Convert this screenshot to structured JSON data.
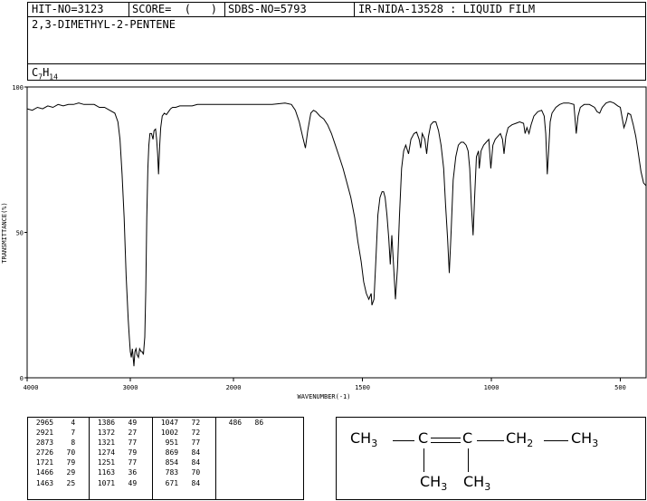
{
  "header": {
    "hit_no": "HIT-NO=3123",
    "score": "SCORE=  (   )",
    "sdbs_no": "SDBS-NO=5793",
    "nida": "IR-NIDA-13528 : LIQUID FILM",
    "compound_name": "2,3-DIMETHYL-2-PENTENE",
    "formula_main": "C",
    "formula_sub1": "7",
    "formula_mid": "H",
    "formula_sub2": "14"
  },
  "chart_data": {
    "type": "line",
    "xlabel": "WAVENUMBER(-1)",
    "ylabel": "TRANSMITTANCE(%)",
    "xlim": [
      4000,
      400
    ],
    "ylim": [
      0,
      100
    ],
    "x_ticks": [
      "4000",
      "3000",
      "2000",
      "1500",
      "1000",
      "500"
    ],
    "y_ticks": [
      "100",
      "50",
      "0"
    ],
    "series": [
      {
        "points": [
          [
            4000,
            92.5
          ],
          [
            3950,
            92
          ],
          [
            3900,
            93
          ],
          [
            3850,
            92.5
          ],
          [
            3800,
            93.5
          ],
          [
            3750,
            93
          ],
          [
            3700,
            94
          ],
          [
            3650,
            93.5
          ],
          [
            3600,
            94
          ],
          [
            3550,
            94
          ],
          [
            3500,
            94.5
          ],
          [
            3450,
            94
          ],
          [
            3400,
            94
          ],
          [
            3350,
            94
          ],
          [
            3300,
            93
          ],
          [
            3250,
            93
          ],
          [
            3200,
            92
          ],
          [
            3150,
            91
          ],
          [
            3120,
            88
          ],
          [
            3100,
            82
          ],
          [
            3080,
            70
          ],
          [
            3060,
            55
          ],
          [
            3040,
            35
          ],
          [
            3020,
            20
          ],
          [
            3010,
            14
          ],
          [
            3000,
            9
          ],
          [
            2990,
            7
          ],
          [
            2980,
            10
          ],
          [
            2965,
            4
          ],
          [
            2955,
            9
          ],
          [
            2945,
            10
          ],
          [
            2935,
            8
          ],
          [
            2921,
            7
          ],
          [
            2910,
            10
          ],
          [
            2895,
            9
          ],
          [
            2885,
            9
          ],
          [
            2873,
            8
          ],
          [
            2860,
            14
          ],
          [
            2850,
            30
          ],
          [
            2840,
            55
          ],
          [
            2830,
            72
          ],
          [
            2820,
            80
          ],
          [
            2810,
            84
          ],
          [
            2795,
            84
          ],
          [
            2780,
            82
          ],
          [
            2770,
            85
          ],
          [
            2755,
            85.5
          ],
          [
            2745,
            82
          ],
          [
            2735,
            77
          ],
          [
            2726,
            70
          ],
          [
            2715,
            80
          ],
          [
            2705,
            86
          ],
          [
            2690,
            90
          ],
          [
            2670,
            91
          ],
          [
            2650,
            90.5
          ],
          [
            2630,
            91.5
          ],
          [
            2610,
            92.5
          ],
          [
            2590,
            93
          ],
          [
            2560,
            93
          ],
          [
            2520,
            93.5
          ],
          [
            2480,
            93.5
          ],
          [
            2440,
            93.5
          ],
          [
            2400,
            93.5
          ],
          [
            2350,
            94
          ],
          [
            2300,
            94
          ],
          [
            2250,
            94
          ],
          [
            2200,
            94
          ],
          [
            2150,
            94
          ],
          [
            2100,
            94
          ],
          [
            2050,
            94
          ],
          [
            2000,
            94
          ],
          [
            1950,
            94
          ],
          [
            1900,
            94
          ],
          [
            1850,
            94
          ],
          [
            1800,
            94.5
          ],
          [
            1775,
            94
          ],
          [
            1760,
            92
          ],
          [
            1745,
            88
          ],
          [
            1732,
            83
          ],
          [
            1721,
            79
          ],
          [
            1712,
            85
          ],
          [
            1700,
            91
          ],
          [
            1690,
            92
          ],
          [
            1680,
            91.5
          ],
          [
            1665,
            90
          ],
          [
            1650,
            89
          ],
          [
            1635,
            87
          ],
          [
            1620,
            84
          ],
          [
            1605,
            80
          ],
          [
            1590,
            76
          ],
          [
            1575,
            72
          ],
          [
            1560,
            67
          ],
          [
            1545,
            62
          ],
          [
            1530,
            55
          ],
          [
            1518,
            47
          ],
          [
            1505,
            40
          ],
          [
            1495,
            33
          ],
          [
            1485,
            29
          ],
          [
            1475,
            27
          ],
          [
            1466,
            29
          ],
          [
            1463,
            25
          ],
          [
            1455,
            27
          ],
          [
            1448,
            40
          ],
          [
            1440,
            56
          ],
          [
            1432,
            62
          ],
          [
            1424,
            64
          ],
          [
            1418,
            64
          ],
          [
            1412,
            62
          ],
          [
            1405,
            56
          ],
          [
            1398,
            48
          ],
          [
            1392,
            39
          ],
          [
            1386,
            49
          ],
          [
            1380,
            40
          ],
          [
            1372,
            27
          ],
          [
            1364,
            38
          ],
          [
            1356,
            56
          ],
          [
            1348,
            72
          ],
          [
            1340,
            78
          ],
          [
            1332,
            80
          ],
          [
            1321,
            77
          ],
          [
            1312,
            82
          ],
          [
            1300,
            84
          ],
          [
            1290,
            84.5
          ],
          [
            1280,
            82
          ],
          [
            1274,
            79
          ],
          [
            1268,
            84
          ],
          [
            1258,
            82
          ],
          [
            1251,
            77
          ],
          [
            1244,
            83
          ],
          [
            1235,
            87
          ],
          [
            1225,
            88
          ],
          [
            1215,
            88
          ],
          [
            1205,
            85
          ],
          [
            1195,
            80
          ],
          [
            1185,
            72
          ],
          [
            1178,
            60
          ],
          [
            1170,
            48
          ],
          [
            1163,
            36
          ],
          [
            1156,
            50
          ],
          [
            1148,
            68
          ],
          [
            1138,
            76
          ],
          [
            1128,
            80
          ],
          [
            1118,
            81
          ],
          [
            1108,
            81
          ],
          [
            1098,
            80
          ],
          [
            1090,
            78
          ],
          [
            1084,
            72
          ],
          [
            1078,
            60
          ],
          [
            1071,
            49
          ],
          [
            1065,
            62
          ],
          [
            1058,
            76
          ],
          [
            1050,
            78
          ],
          [
            1047,
            72
          ],
          [
            1040,
            78
          ],
          [
            1030,
            80
          ],
          [
            1020,
            81
          ],
          [
            1010,
            82
          ],
          [
            1002,
            72
          ],
          [
            994,
            80
          ],
          [
            985,
            82
          ],
          [
            975,
            83
          ],
          [
            965,
            84
          ],
          [
            957,
            82
          ],
          [
            951,
            77
          ],
          [
            944,
            83
          ],
          [
            935,
            86
          ],
          [
            920,
            87
          ],
          [
            905,
            87.5
          ],
          [
            890,
            88
          ],
          [
            875,
            87.5
          ],
          [
            869,
            84
          ],
          [
            862,
            86
          ],
          [
            854,
            84
          ],
          [
            846,
            87
          ],
          [
            835,
            90
          ],
          [
            820,
            91.5
          ],
          [
            805,
            92
          ],
          [
            795,
            90
          ],
          [
            789,
            84
          ],
          [
            783,
            70
          ],
          [
            778,
            78
          ],
          [
            772,
            88
          ],
          [
            765,
            91
          ],
          [
            750,
            93
          ],
          [
            735,
            94
          ],
          [
            720,
            94.5
          ],
          [
            700,
            94.5
          ],
          [
            680,
            94
          ],
          [
            671,
            84
          ],
          [
            664,
            90
          ],
          [
            655,
            93
          ],
          [
            640,
            94
          ],
          [
            620,
            94
          ],
          [
            600,
            93
          ],
          [
            590,
            91.5
          ],
          [
            580,
            91
          ],
          [
            570,
            93
          ],
          [
            555,
            94.5
          ],
          [
            540,
            95
          ],
          [
            525,
            94.5
          ],
          [
            510,
            93.5
          ],
          [
            500,
            93
          ],
          [
            486,
            86
          ],
          [
            478,
            88
          ],
          [
            470,
            91
          ],
          [
            460,
            90.5
          ],
          [
            450,
            87
          ],
          [
            440,
            83
          ],
          [
            430,
            77
          ],
          [
            420,
            71
          ],
          [
            410,
            67
          ],
          [
            400,
            66
          ]
        ]
      }
    ],
    "peaks": [
      [
        "2965",
        "4"
      ],
      [
        "2921",
        "7"
      ],
      [
        "2873",
        "8"
      ],
      [
        "2726",
        "70"
      ],
      [
        "1721",
        "79"
      ],
      [
        "1466",
        "29"
      ],
      [
        "1463",
        "25"
      ],
      [
        "1386",
        "49"
      ],
      [
        "1372",
        "27"
      ],
      [
        "1321",
        "77"
      ],
      [
        "1274",
        "79"
      ],
      [
        "1251",
        "77"
      ],
      [
        "1163",
        "36"
      ],
      [
        "1071",
        "49"
      ],
      [
        "1047",
        "72"
      ],
      [
        "1002",
        "72"
      ],
      [
        "951",
        "77"
      ],
      [
        "869",
        "84"
      ],
      [
        "854",
        "84"
      ],
      [
        "783",
        "70"
      ],
      [
        "671",
        "84"
      ],
      [
        "486",
        "86"
      ]
    ]
  },
  "structure": {
    "row1": [
      "CH",
      "3",
      "C",
      "C",
      "CH",
      "2",
      "CH",
      "3"
    ],
    "row2": [
      "CH",
      "3",
      "CH",
      "3"
    ]
  }
}
